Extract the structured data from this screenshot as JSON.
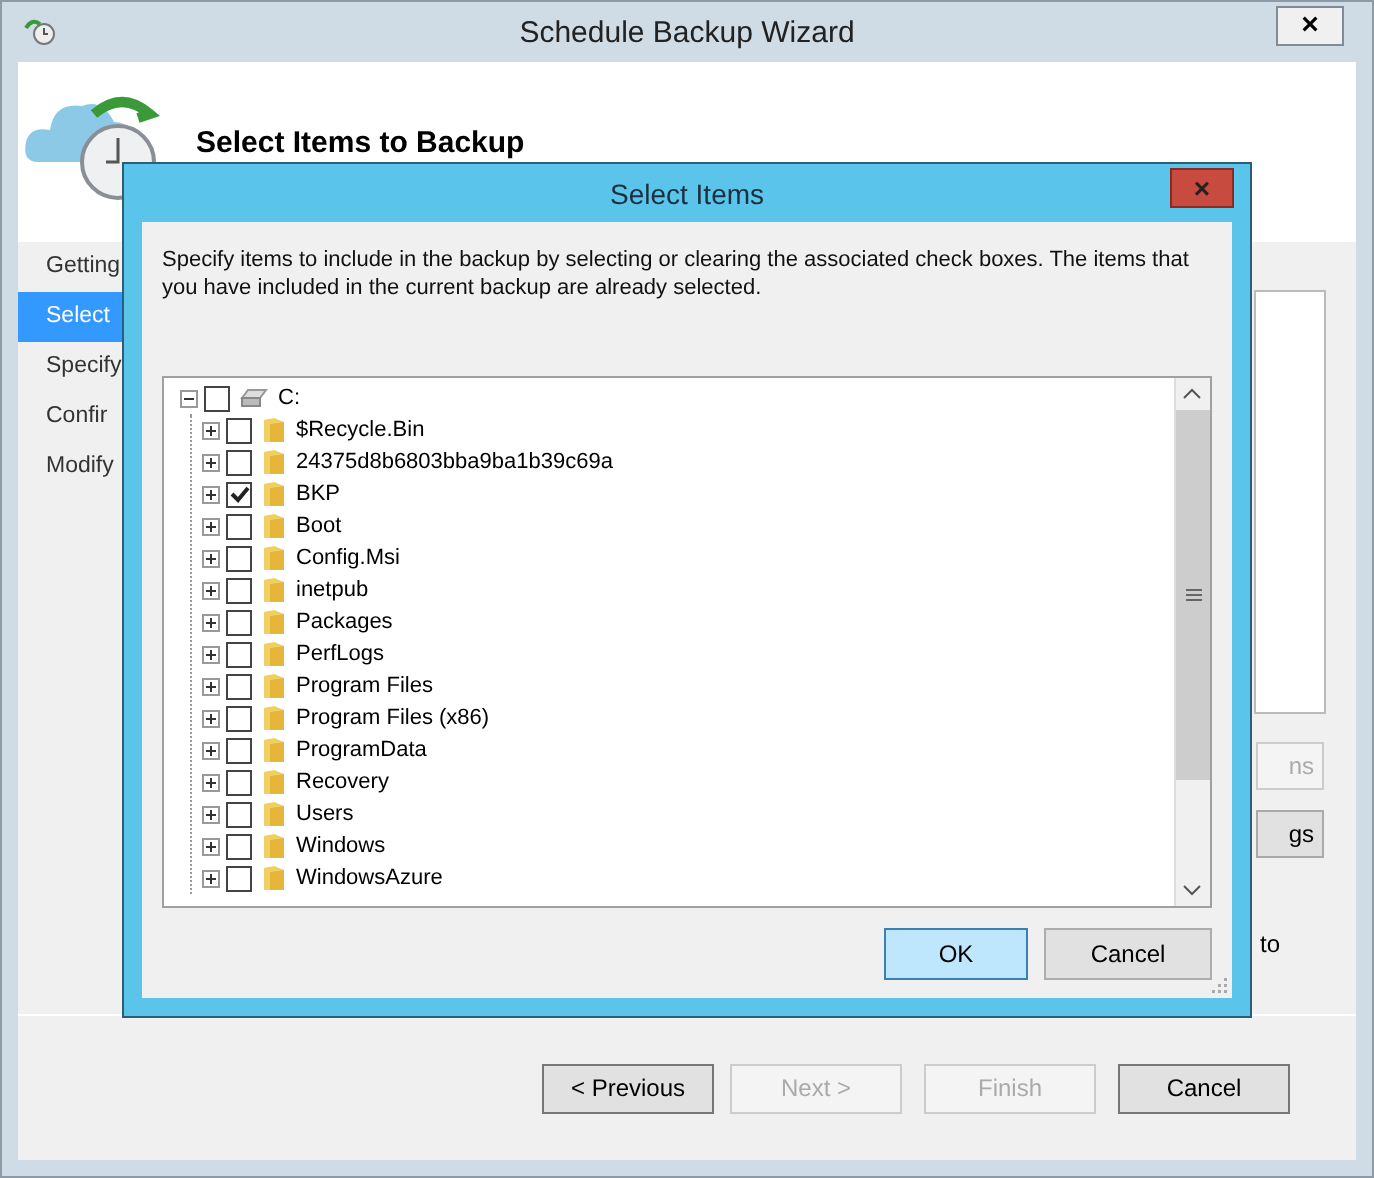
{
  "window": {
    "title": "Schedule Backup Wizard",
    "close": "×"
  },
  "header": {
    "title": "Select Items to Backup"
  },
  "sidebar": {
    "items": [
      {
        "label": "Getting",
        "selected": false
      },
      {
        "label": "Select",
        "selected": true
      },
      {
        "label": "Specify",
        "selected": false
      },
      {
        "label": "Confir",
        "selected": false
      },
      {
        "label": "Modify",
        "selected": false
      }
    ]
  },
  "right_pane": {
    "buttons": [
      {
        "label": "ns",
        "disabled": true
      },
      {
        "label": "gs",
        "disabled": false
      }
    ],
    "text": "to"
  },
  "footer": {
    "buttons": [
      {
        "label": "< Previous",
        "disabled": false
      },
      {
        "label": "Next >",
        "disabled": true
      },
      {
        "label": "Finish",
        "disabled": true
      },
      {
        "label": "Cancel",
        "disabled": false
      }
    ]
  },
  "dialog": {
    "title": "Select Items",
    "close": "×",
    "description": "Specify items to include in the backup by selecting or clearing the associated check boxes. The items that you have included in the current backup are already selected.",
    "tree": {
      "kind": "drive",
      "label": "C:",
      "checked": false,
      "expanded": true,
      "children": [
        {
          "kind": "folder",
          "label": "$Recycle.Bin",
          "checked": false,
          "expanded": false
        },
        {
          "kind": "folder",
          "label": "24375d8b6803bba9ba1b39c69a",
          "checked": false,
          "expanded": false
        },
        {
          "kind": "folder",
          "label": "BKP",
          "checked": true,
          "expanded": false
        },
        {
          "kind": "folder",
          "label": "Boot",
          "checked": false,
          "expanded": false
        },
        {
          "kind": "folder",
          "label": "Config.Msi",
          "checked": false,
          "expanded": false
        },
        {
          "kind": "folder",
          "label": "inetpub",
          "checked": false,
          "expanded": false
        },
        {
          "kind": "folder",
          "label": "Packages",
          "checked": false,
          "expanded": false
        },
        {
          "kind": "folder",
          "label": "PerfLogs",
          "checked": false,
          "expanded": false
        },
        {
          "kind": "folder",
          "label": "Program Files",
          "checked": false,
          "expanded": false
        },
        {
          "kind": "folder",
          "label": "Program Files (x86)",
          "checked": false,
          "expanded": false
        },
        {
          "kind": "folder",
          "label": "ProgramData",
          "checked": false,
          "expanded": false
        },
        {
          "kind": "folder",
          "label": "Recovery",
          "checked": false,
          "expanded": false
        },
        {
          "kind": "folder",
          "label": "Users",
          "checked": false,
          "expanded": false
        },
        {
          "kind": "folder",
          "label": "Windows",
          "checked": false,
          "expanded": false
        },
        {
          "kind": "folder",
          "label": "WindowsAzure",
          "checked": false,
          "expanded": false
        }
      ]
    },
    "buttons": [
      {
        "label": "OK",
        "selected": true
      },
      {
        "label": "Cancel",
        "selected": false
      }
    ]
  }
}
